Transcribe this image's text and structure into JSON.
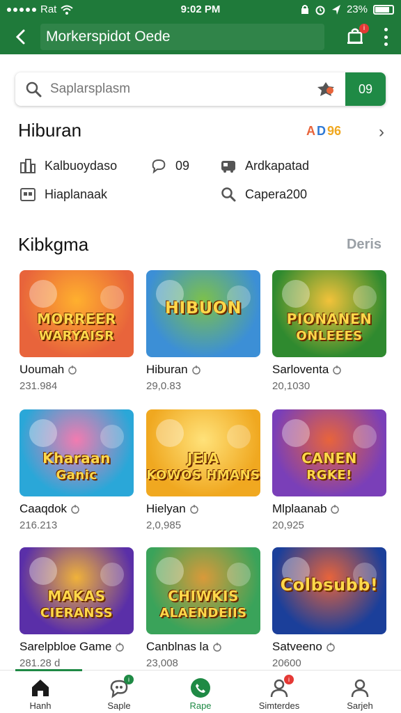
{
  "status": {
    "carrier": "Rat",
    "time": "9:02 PM",
    "battery": "23%"
  },
  "appbar": {
    "title": "Morkerspidot Oede",
    "notif_badge": "i"
  },
  "search": {
    "placeholder": "Saplarsplasm",
    "button": "09"
  },
  "hiburan": {
    "title": "Hiburan",
    "badge_a": "A",
    "badge_d": "D",
    "badge_num": "96",
    "categories": [
      {
        "label": "Kalbuoydaso",
        "icon": "building-icon"
      },
      {
        "label": "09",
        "icon": "chat-icon"
      },
      {
        "label": "Ardkapatad",
        "icon": "car-icon"
      },
      {
        "label": "Hiaplanaak",
        "icon": "calendar-icon"
      },
      {
        "label": "",
        "icon": ""
      },
      {
        "label": "Capera200",
        "icon": "search-icon"
      }
    ]
  },
  "kibkgma": {
    "title": "Kibkgma",
    "see_all": "Deris",
    "games": [
      {
        "name": "Uoumah",
        "meta": "231.984",
        "art": [
          "MORREER",
          "WARYAISR"
        ],
        "bg": "#e8643b",
        "bg2": "#ffb02e"
      },
      {
        "name": "Hiburan",
        "meta": "29,0.83",
        "art": [
          "HIBUON",
          ""
        ],
        "bg": "#3c8fd6",
        "bg2": "#7dc14a"
      },
      {
        "name": "Sarloventa",
        "meta": "20,1030",
        "art": [
          "PIONANEN",
          "ONLEEES"
        ],
        "bg": "#2f8a2f",
        "bg2": "#f2c23a"
      },
      {
        "name": "Caaqdok",
        "meta": "216.213",
        "art": [
          "Kharaan",
          "Ganic"
        ],
        "bg": "#2aa7d8",
        "bg2": "#f27bb0"
      },
      {
        "name": "Hielyan",
        "meta": "2,0,985",
        "art": [
          "JEIA",
          "KOWOS HMANS"
        ],
        "bg": "#f0a820",
        "bg2": "#ffe27a"
      },
      {
        "name": "Mlplaanab",
        "meta": "20,925",
        "art": [
          "CANEN",
          "RGKE!"
        ],
        "bg": "#7a3fb8",
        "bg2": "#e8643b"
      },
      {
        "name": "Sarelpbloe Game",
        "meta": "281.28 d",
        "art": [
          "MAKAS",
          "CIERANSS"
        ],
        "bg": "#5a2fa8",
        "bg2": "#f0b23a"
      },
      {
        "name": "Canblnas la",
        "meta": "23,008",
        "art": [
          "CHIWKIS",
          "ALAENDEIIS"
        ],
        "bg": "#3aa35a",
        "bg2": "#d99a3a"
      },
      {
        "name": "Satveeno",
        "meta": "20600",
        "art": [
          "Colbsubb!",
          ""
        ],
        "bg": "#1b3f9a",
        "bg2": "#e8643b"
      }
    ]
  },
  "nav": [
    {
      "label": "Hanh",
      "icon": "home-icon",
      "badge": ""
    },
    {
      "label": "Saple",
      "icon": "chat-bubble-icon",
      "badge": "i"
    },
    {
      "label": "Rape",
      "icon": "phone-icon",
      "badge": ""
    },
    {
      "label": "Simterdes",
      "icon": "person-alert-icon",
      "badge": "i"
    },
    {
      "label": "Sarjeh",
      "icon": "profile-icon",
      "badge": ""
    }
  ],
  "colors": {
    "primary": "#1f7a3a",
    "accent": "#1f8a45",
    "badge": "#e53935"
  }
}
